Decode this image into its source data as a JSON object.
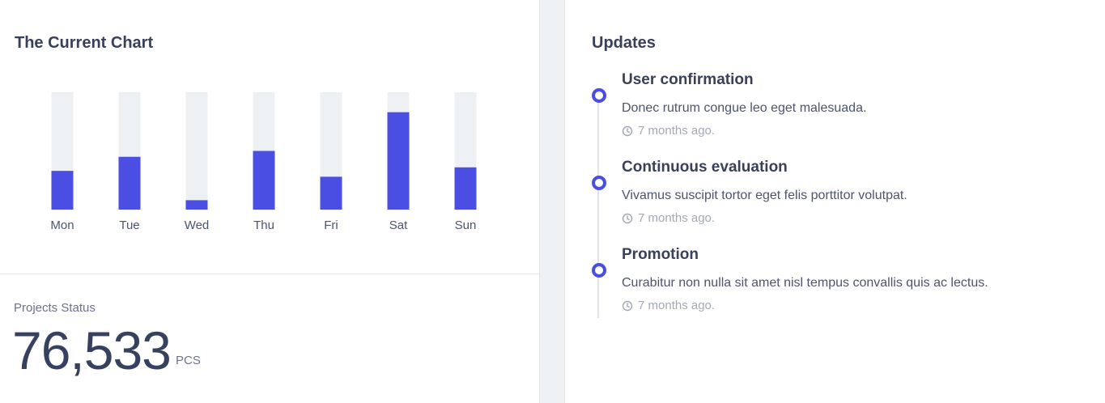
{
  "current_chart": {
    "title": "The Current Chart"
  },
  "chart_data": {
    "type": "bar",
    "title": "The Current Chart",
    "categories": [
      "Mon",
      "Tue",
      "Wed",
      "Thu",
      "Fri",
      "Sat",
      "Sun"
    ],
    "values": [
      33,
      45,
      8,
      50,
      28,
      83,
      36
    ],
    "ylim": [
      0,
      100
    ],
    "xlabel": "",
    "ylabel": "",
    "grid": false,
    "colors": {
      "bar": "#4a4ee3",
      "track": "#eef1f4",
      "label": "#4c5470"
    }
  },
  "projects_status": {
    "label": "Projects Status",
    "value": "76,533",
    "unit": "PCS"
  },
  "updates": {
    "title": "Updates",
    "items": [
      {
        "title": "User confirmation",
        "description": "Donec rutrum congue leo eget malesuada.",
        "time": "7 months ago."
      },
      {
        "title": "Continuous evaluation",
        "description": "Vivamus suscipit tortor eget felis porttitor volutpat.",
        "time": "7 months ago."
      },
      {
        "title": "Promotion",
        "description": "Curabitur non nulla sit amet nisl tempus convallis quis ac lectus.",
        "time": "7 months ago."
      }
    ]
  },
  "theme": {
    "accent": "#4a4ee3",
    "text_dark": "#39405a",
    "muted": "#a3a9b8"
  }
}
